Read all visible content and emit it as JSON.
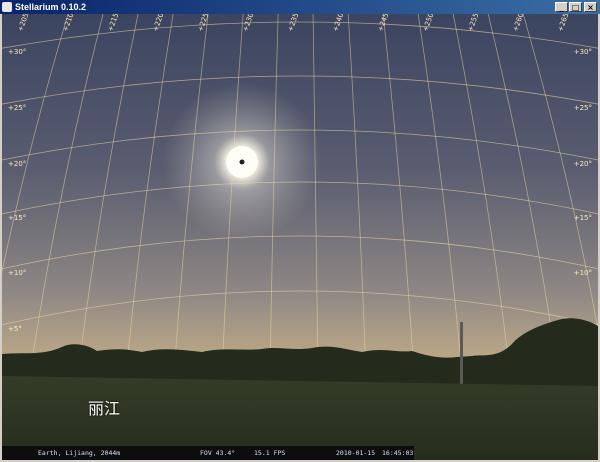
{
  "window": {
    "title": "Stellarium 0.10.2",
    "buttons": {
      "minimize": "_",
      "maximize": "□",
      "close": "×"
    }
  },
  "sky": {
    "altitude_labels": [
      "+30°",
      "+25°",
      "+20°",
      "+15°",
      "+10°",
      "+5°"
    ],
    "azimuth_labels": [
      "+205°",
      "+210°",
      "+215°",
      "+220°",
      "+225°",
      "+230°",
      "+235°",
      "+240°",
      "+245°",
      "+250°",
      "+255°",
      "+260°",
      "+265°"
    ],
    "location_label": "丽江",
    "colors": {
      "sky_top": "#3b4460",
      "sky_mid": "#6f6f78",
      "horizon_glow": "#d6b98a",
      "ground": "#2c3420",
      "grid": "#f2d9a8"
    }
  },
  "status": {
    "location": "Earth, Lijiang, 2044m",
    "fov": "FOV 43.4°",
    "fps": "15.1 FPS",
    "date": "2010-01-15",
    "time": "16:45:03"
  }
}
